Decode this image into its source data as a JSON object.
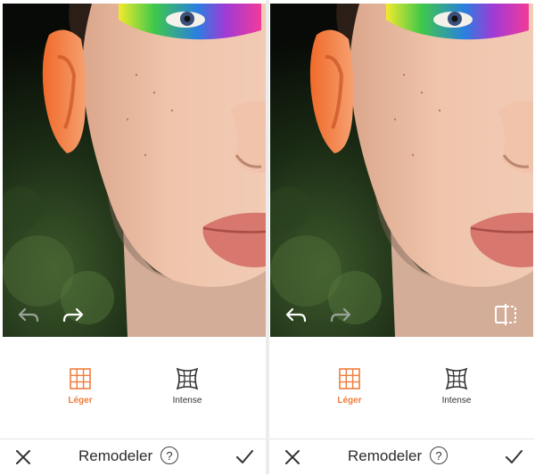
{
  "colors": {
    "accent": "#ef7d3c",
    "inactive_icon": "#333333",
    "photo_icon_active": "#ffffff",
    "photo_icon_disabled": "#9aa39a"
  },
  "panels": [
    {
      "undo": {
        "icon": "undo-arrow-icon",
        "enabled": false
      },
      "redo": {
        "icon": "redo-arrow-icon",
        "enabled": true
      },
      "compare": null,
      "modes": [
        {
          "label": "Léger",
          "icon": "grid-light-icon",
          "selected": true
        },
        {
          "label": "Intense",
          "icon": "grid-warp-icon",
          "selected": false
        }
      ],
      "bottom_bar": {
        "close_icon": "close-icon",
        "title": "Remodeler",
        "help_icon": "?",
        "confirm_icon": "checkmark-icon"
      }
    },
    {
      "undo": {
        "icon": "undo-arrow-icon",
        "enabled": true
      },
      "redo": {
        "icon": "redo-arrow-icon",
        "enabled": false
      },
      "compare": {
        "icon": "compare-split-icon"
      },
      "modes": [
        {
          "label": "Léger",
          "icon": "grid-light-icon",
          "selected": true
        },
        {
          "label": "Intense",
          "icon": "grid-warp-icon",
          "selected": false
        }
      ],
      "bottom_bar": {
        "close_icon": "close-icon",
        "title": "Remodeler",
        "help_icon": "?",
        "confirm_icon": "checkmark-icon"
      }
    }
  ]
}
